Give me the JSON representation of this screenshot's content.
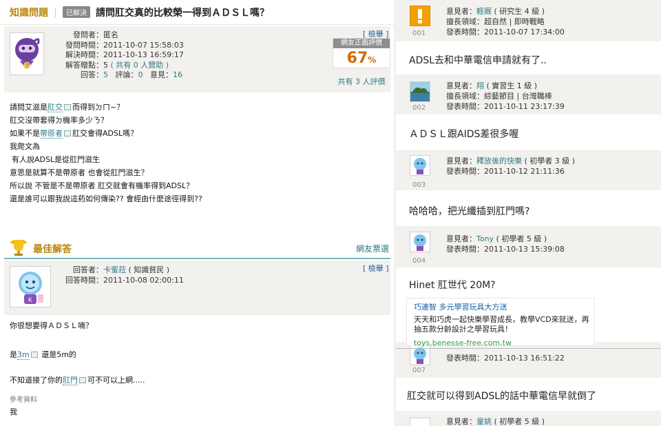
{
  "title_bar": {
    "section": "知識問題",
    "status_badge": "已解決",
    "question_title": "請問肛交真的比較榮一得到ＡＤＳＬ嗎？"
  },
  "question_info": {
    "asker_label": "發問者：",
    "asker_value": "匿名",
    "asked_time_label": "發問時間：",
    "asked_time_value": "2011-10-07 15:58:03",
    "solved_time_label": "解決時間：",
    "solved_time_value": "2011-10-13 16:59:17",
    "points_label": "解答贈點：",
    "points_value": "5",
    "sponsor_text": "( 共有 0 人贊助 )",
    "answers_label": "回答：",
    "answers_value": "5",
    "comments_label": "評論：",
    "comments_value": "0",
    "opinions_label": "意見：",
    "opinions_value": "16",
    "report": "[ 檢舉 ]",
    "rating_label": "網友正面評價",
    "rating_value": "67",
    "rating_unit": "%",
    "rating_count": "共有 3 人評價"
  },
  "question_body": {
    "line1_a": "請問艾滋是",
    "line1_link": "肛交",
    "line1_b": "而得到ㄉㄇ~？",
    "line2": "肛交沒帶套得ㄉ機率多少ㄋ？",
    "line3_a": "如果不是",
    "line3_link": "帶原者",
    "line3_b": "肛交會得ADSL嗎？",
    "line4": "我爬文為",
    "line5": "有人說ADSL是從肛門滋生",
    "line6": "意思是就算不是帶原者 也會從肛門滋生？",
    "line7": "所以說 不管是不是帶原者 肛交就會有機率得到ADSL？",
    "line8": "還是誰可以跟我說這葯如何傳染?? 會經由什麼途徑得到??"
  },
  "best_answer": {
    "label": "最佳解答",
    "vote_link": "網友票選",
    "answerer_label": "回答者：",
    "answerer_value": "卡蜜菈",
    "answerer_level": "( 知識貧民 )",
    "answer_time_label": "回答時間：",
    "answer_time_value": "2011-10-08 02:00:11",
    "report": "[ 檢舉 ]",
    "body_line1": "你很想要得ＡＤＳＬ喃？",
    "body_line2_a": "是",
    "body_line2_link": "3m",
    "body_line2_b": "還是5m的",
    "body_line3_a": "不知道接了你的",
    "body_line3_link": "肛門",
    "body_line3_b": "可不可以上網.....",
    "ref_label": "參考資料",
    "ref_value": "我"
  },
  "opinions": [
    {
      "index": "001",
      "user": "輕厩",
      "level": "( 研究生 4 級 )",
      "field_label": "擅長領域：",
      "field": "超自然 | 即時戰略",
      "time_label": "發表時間：",
      "time": "2011-10-07 17:34:00",
      "user_label": "意見者：",
      "text": "ADSL去和中華電信申請就有了.."
    },
    {
      "index": "002",
      "user": "翔",
      "level": "( 實習生 1 級 )",
      "field_label": "擅長領域：",
      "field": "綜藝節目 | 台灣職棒",
      "time_label": "發表時間：",
      "time": "2011-10-11 23:17:39",
      "user_label": "意見者：",
      "text": "ＡＤＳＬ跟AIDS差很多喔"
    },
    {
      "index": "003",
      "user": "釋放後的快樂",
      "level": "( 初學者 3 級 )",
      "time_label": "發表時間：",
      "time": "2011-10-12 21:11:36",
      "user_label": "意見者：",
      "text": "哈哈哈，把光纖插到肛門嗎?"
    },
    {
      "index": "004",
      "user": "Tony",
      "level": "( 初學者 5 級 )",
      "time_label": "發表時間：",
      "time": "2011-10-13 15:39:08",
      "user_label": "意見者：",
      "text": "Hinet 肛世代 20M?"
    },
    {
      "index": "007",
      "time_label": "發表時間：",
      "time": "2011-10-13 16:51:22",
      "text": "肛交就可以得到ADSL的話中華電信早就倒了"
    },
    {
      "user_label": "意見者：",
      "user": "童姚",
      "level": "( 初學者 5 級 )"
    }
  ],
  "ad": {
    "title": "巧連智 多元學習玩具大方送",
    "body": "天天和巧虎一起快樂學習成長，教學VCD來就送，再抽五款分齡設計之學習玩具！",
    "url": "toys.benesse-free.com.tw"
  },
  "colors": {
    "accent_gold": "#b8860b",
    "link_teal": "#2c7b87",
    "rating_orange": "#d46a00",
    "info_bg": "#f3f1ed"
  }
}
